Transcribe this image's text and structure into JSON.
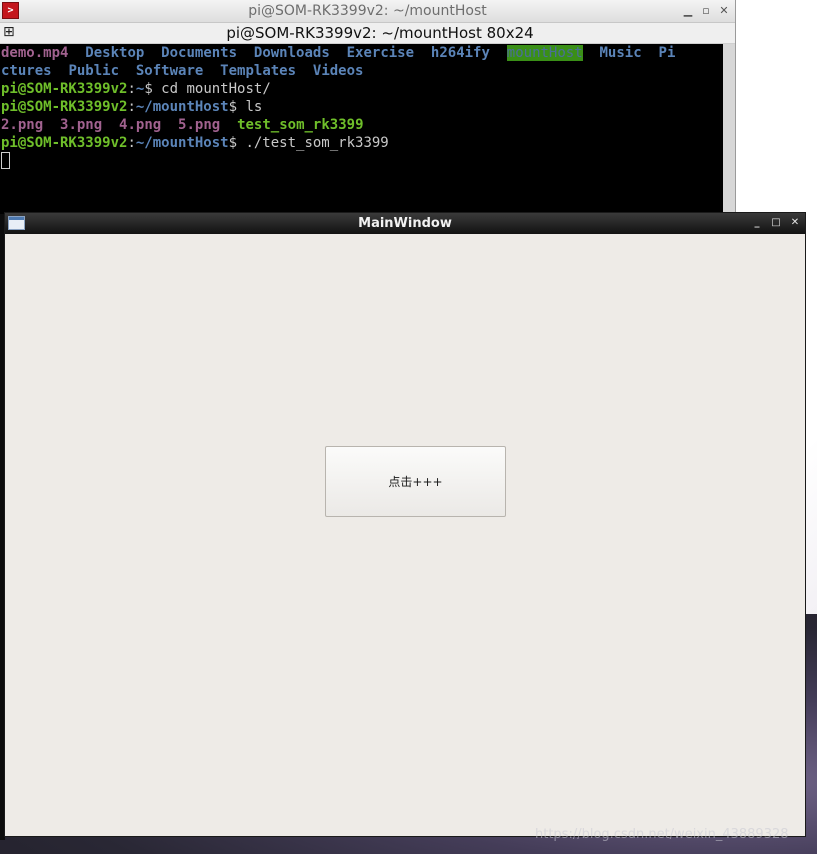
{
  "terminal": {
    "window_title": "pi@SOM-RK3399v2: ~/mountHost",
    "tab_title": "pi@SOM-RK3399v2: ~/mountHost 80x24",
    "controls": {
      "minimize": "▁",
      "maximize": "▫",
      "close": "✕"
    },
    "ls_home": {
      "row1": [
        "demo.mp4",
        "Desktop",
        "Documents",
        "Downloads",
        "Exercise",
        "h264ify",
        "mountHost",
        "Music",
        "Pi"
      ],
      "row2": [
        "ctures",
        "Public",
        "Software",
        "Templates",
        "Videos"
      ]
    },
    "prompt_user": "pi@SOM-RK3399v2",
    "prompt_sep": ":",
    "path_home": "~",
    "path_mount": "~/mountHost",
    "cmd1": "$ cd mountHost/",
    "cmd2": "$ ls",
    "cmd3": "$ ./test_som_rk3399",
    "ls_mount": [
      "2.png",
      "3.png",
      "4.png",
      "5.png",
      "test_som_rk3399"
    ]
  },
  "main_window": {
    "title": "MainWindow",
    "controls": {
      "minimize": "_",
      "maximize": "□",
      "close": "✕"
    },
    "button_label": "点击+++"
  },
  "watermark": "https://blog.csdn.net/weixin_43889328",
  "colors": {
    "terminal_bg": "#000000",
    "dir": "#5b84b8",
    "media": "#a1628f",
    "exe": "#6fbf2a",
    "highlight_bg": "#3a8f17",
    "main_bg": "#eeebe7"
  }
}
